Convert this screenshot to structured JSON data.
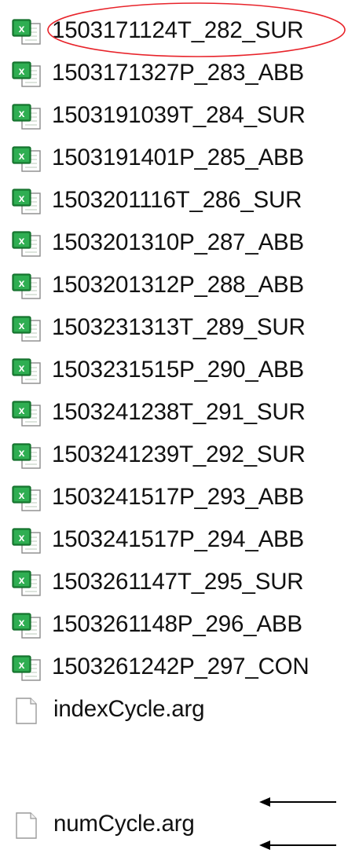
{
  "files": [
    {
      "name": "1503171124T_282_SUR",
      "icon": "excel-icon"
    },
    {
      "name": "1503171327P_283_ABB",
      "icon": "excel-icon"
    },
    {
      "name": "1503191039T_284_SUR",
      "icon": "excel-icon"
    },
    {
      "name": "1503191401P_285_ABB",
      "icon": "excel-icon"
    },
    {
      "name": "1503201116T_286_SUR",
      "icon": "excel-icon"
    },
    {
      "name": "1503201310P_287_ABB",
      "icon": "excel-icon"
    },
    {
      "name": "1503201312P_288_ABB",
      "icon": "excel-icon"
    },
    {
      "name": "1503231313T_289_SUR",
      "icon": "excel-icon"
    },
    {
      "name": "1503231515P_290_ABB",
      "icon": "excel-icon"
    },
    {
      "name": "1503241238T_291_SUR",
      "icon": "excel-icon"
    },
    {
      "name": "1503241239T_292_SUR",
      "icon": "excel-icon"
    },
    {
      "name": "1503241517P_293_ABB",
      "icon": "excel-icon"
    },
    {
      "name": "1503241517P_294_ABB",
      "icon": "excel-icon"
    },
    {
      "name": "1503261147T_295_SUR",
      "icon": "excel-icon"
    },
    {
      "name": "1503261148P_296_ABB",
      "icon": "excel-icon"
    },
    {
      "name": "1503261242P_297_CON",
      "icon": "excel-icon"
    },
    {
      "name": "indexCycle.arg",
      "icon": "blank-file-icon"
    },
    {
      "name": "numCycle.arg",
      "icon": "blank-file-icon"
    }
  ],
  "annotations": {
    "highlight_color": "#e8232a",
    "arrow_color": "#000000",
    "circled_item": "1503171124T_282_SUR",
    "arrow_items": [
      "indexCycle.arg",
      "numCycle.arg"
    ]
  }
}
